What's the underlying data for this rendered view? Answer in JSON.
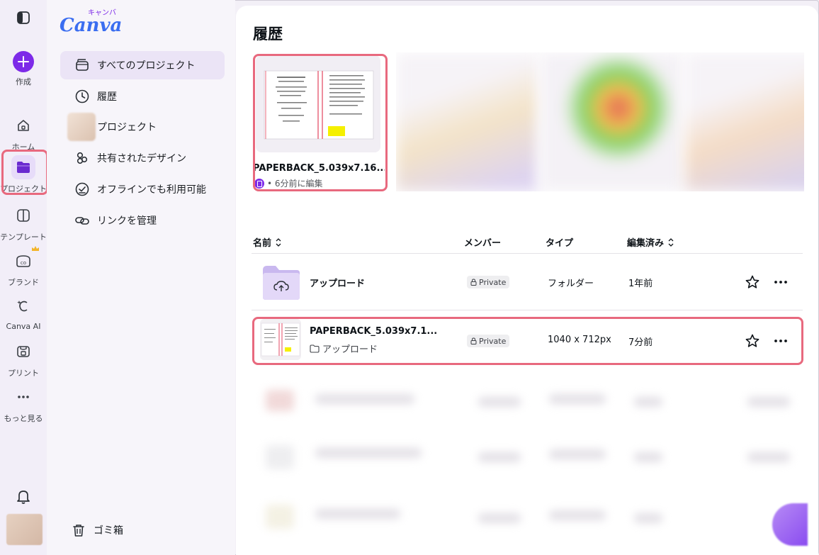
{
  "app": {
    "logo_text": "Canva",
    "logo_sub": "キャンバ"
  },
  "rail": {
    "create_label": "作成",
    "items": [
      {
        "label": "ホーム"
      },
      {
        "label": "プロジェクト"
      },
      {
        "label": "テンプレート"
      },
      {
        "label": "ブランド"
      },
      {
        "label": "Canva AI"
      },
      {
        "label": "プリント"
      },
      {
        "label": "もっと見る"
      }
    ]
  },
  "sidebar": {
    "items": [
      {
        "label": "すべてのプロジェクト"
      },
      {
        "label": "履歴"
      },
      {
        "label": "プロジェクト"
      },
      {
        "label": "共有されたデザイン"
      },
      {
        "label": "オフラインでも利用可能"
      },
      {
        "label": "リンクを管理"
      }
    ],
    "trash_label": "ゴミ箱"
  },
  "main": {
    "title": "履歴",
    "recent": {
      "name": "PAPERBACK_5.039x7.16...",
      "meta": "• 6分前に編集"
    },
    "table": {
      "headers": {
        "name": "名前",
        "members": "メンバー",
        "type": "タイプ",
        "edited": "編集済み"
      },
      "rows": [
        {
          "title": "アップロード",
          "privacy": "Private",
          "type": "フォルダー",
          "edited": "1年前"
        },
        {
          "title": "PAPERBACK_5.039x7.1...",
          "subtitle": "アップロード",
          "privacy": "Private",
          "type": "1040 x 712px",
          "edited": "7分前"
        }
      ]
    }
  },
  "colors": {
    "accent": "#7d2ae8",
    "highlight": "#e8697e"
  }
}
